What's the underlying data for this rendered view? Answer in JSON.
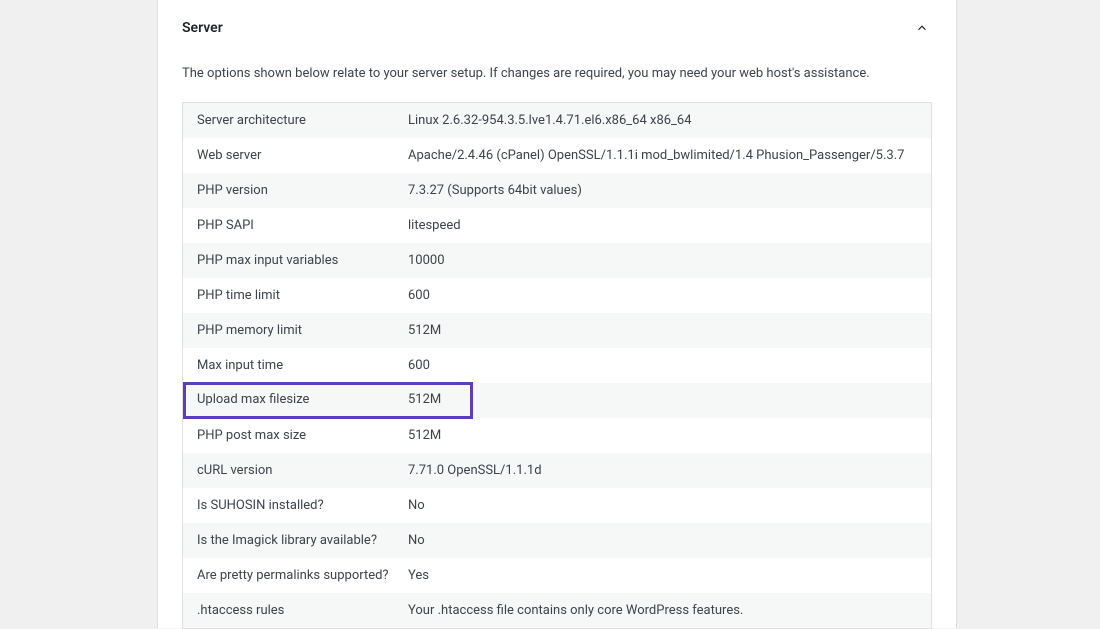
{
  "section": {
    "title": "Server",
    "description": "The options shown below relate to your server setup. If changes are required, you may need your web host's assistance."
  },
  "rows": [
    {
      "label": "Server architecture",
      "value": "Linux 2.6.32-954.3.5.lve1.4.71.el6.x86_64 x86_64"
    },
    {
      "label": "Web server",
      "value": "Apache/2.4.46 (cPanel) OpenSSL/1.1.1i mod_bwlimited/1.4 Phusion_Passenger/5.3.7"
    },
    {
      "label": "PHP version",
      "value": "7.3.27 (Supports 64bit values)"
    },
    {
      "label": "PHP SAPI",
      "value": "litespeed"
    },
    {
      "label": "PHP max input variables",
      "value": "10000"
    },
    {
      "label": "PHP time limit",
      "value": "600"
    },
    {
      "label": "PHP memory limit",
      "value": "512M"
    },
    {
      "label": "Max input time",
      "value": "600"
    },
    {
      "label": "Upload max filesize",
      "value": "512M"
    },
    {
      "label": "PHP post max size",
      "value": "512M"
    },
    {
      "label": "cURL version",
      "value": "7.71.0 OpenSSL/1.1.1d"
    },
    {
      "label": "Is SUHOSIN installed?",
      "value": "No"
    },
    {
      "label": "Is the Imagick library available?",
      "value": "No"
    },
    {
      "label": "Are pretty permalinks supported?",
      "value": "Yes"
    },
    {
      "label": ".htaccess rules",
      "value": "Your .htaccess file contains only core WordPress features."
    }
  ],
  "highlightIndex": 8
}
